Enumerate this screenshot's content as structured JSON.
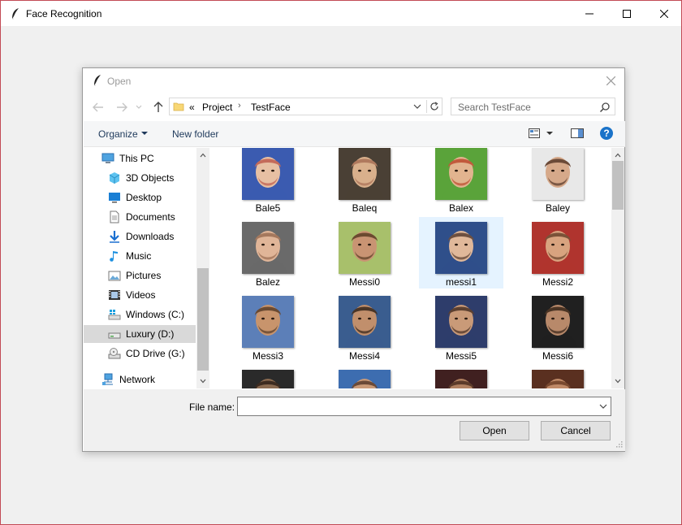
{
  "app": {
    "title": "Face Recognition"
  },
  "dialog": {
    "title": "Open",
    "address": {
      "chevron": "«",
      "crumbs": [
        "Project",
        "TestFace"
      ]
    },
    "search": {
      "placeholder": "Search TestFace"
    },
    "toolbar": {
      "organize_label": "Organize",
      "new_folder_label": "New folder",
      "help_label": "?"
    },
    "navigation": [
      {
        "label": "This PC",
        "icon": "computer-icon",
        "indent": 0
      },
      {
        "label": "3D Objects",
        "icon": "cube-icon",
        "indent": 1
      },
      {
        "label": "Desktop",
        "icon": "desktop-icon",
        "indent": 1
      },
      {
        "label": "Documents",
        "icon": "document-icon",
        "indent": 1
      },
      {
        "label": "Downloads",
        "icon": "download-icon",
        "indent": 1
      },
      {
        "label": "Music",
        "icon": "music-icon",
        "indent": 1
      },
      {
        "label": "Pictures",
        "icon": "pictures-icon",
        "indent": 1
      },
      {
        "label": "Videos",
        "icon": "video-icon",
        "indent": 1
      },
      {
        "label": "Windows (C:)",
        "icon": "windows-drive-icon",
        "indent": 1
      },
      {
        "label": "Luxury (D:)",
        "icon": "drive-icon",
        "indent": 1,
        "selected": true
      },
      {
        "label": "CD Drive (G:)",
        "icon": "cd-drive-icon",
        "indent": 1
      },
      {
        "label": "Network",
        "icon": "network-icon",
        "indent": 0
      }
    ],
    "files": [
      {
        "name": "Bale5",
        "colors": [
          "#3b5bb0",
          "#c46b5a",
          "#e7c0a3"
        ]
      },
      {
        "name": "Baleq",
        "colors": [
          "#4a4035",
          "#b07a5e",
          "#d9b08c"
        ]
      },
      {
        "name": "Balex",
        "colors": [
          "#5aa33a",
          "#c25a3c",
          "#e2b48f"
        ]
      },
      {
        "name": "Baley",
        "colors": [
          "#e8e8e8",
          "#6b4a38",
          "#d6a98a"
        ]
      },
      {
        "name": "Balez",
        "colors": [
          "#6a6a6a",
          "#a5785d",
          "#e0b598"
        ]
      },
      {
        "name": "Messi0",
        "colors": [
          "#a8c06b",
          "#6b4a30",
          "#c99473"
        ]
      },
      {
        "name": "messi1",
        "colors": [
          "#2f4f8a",
          "#6e5040",
          "#e0b89a"
        ],
        "selected": true
      },
      {
        "name": "Messi2",
        "colors": [
          "#b0342e",
          "#7a5238",
          "#d8a37f"
        ]
      },
      {
        "name": "Messi3",
        "colors": [
          "#5c7fb8",
          "#6a4a32",
          "#c8946c"
        ]
      },
      {
        "name": "Messi4",
        "colors": [
          "#3a5d8f",
          "#4a3526",
          "#c18f6c"
        ]
      },
      {
        "name": "Messi5",
        "colors": [
          "#2e3d6b",
          "#5c4030",
          "#c99a78"
        ]
      },
      {
        "name": "Messi6",
        "colors": [
          "#202020",
          "#4a3424",
          "#b8896a"
        ]
      },
      {
        "name": "",
        "colors": [
          "#2a2a2a",
          "#3d2b20",
          "#8a6a50"
        ]
      },
      {
        "name": "",
        "colors": [
          "#3d6db0",
          "#6a4a38",
          "#c99a78"
        ]
      },
      {
        "name": "",
        "colors": [
          "#402020",
          "#5c3b2a",
          "#b08060"
        ]
      },
      {
        "name": "",
        "colors": [
          "#5a3020",
          "#7a4a30",
          "#c08a68"
        ]
      }
    ],
    "filename": {
      "label": "File name:",
      "value": ""
    },
    "buttons": {
      "open": "Open",
      "cancel": "Cancel"
    }
  }
}
